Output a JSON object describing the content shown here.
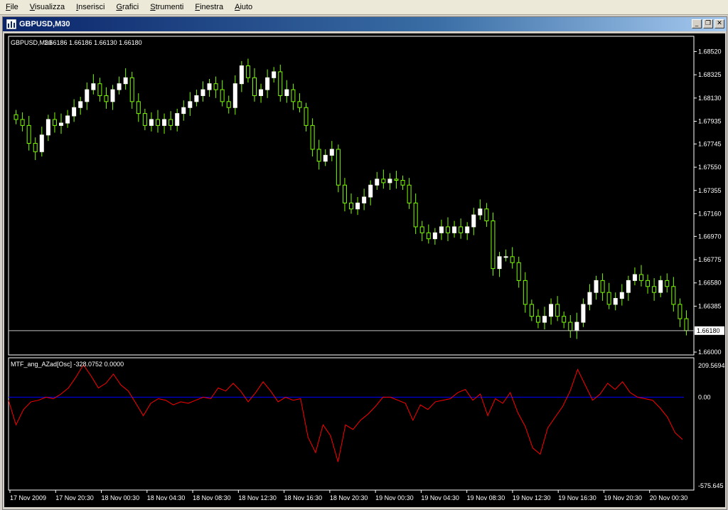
{
  "menu": [
    "File",
    "Visualizza",
    "Inserisci",
    "Grafici",
    "Strumenti",
    "Finestra",
    "Aiuto"
  ],
  "window": {
    "title": "GBPUSD,M30"
  },
  "price_panel": {
    "header_symbol": "GBPUSD,M30",
    "header_ohlc": "1.66186 1.66186 1.66130 1.66180",
    "current_price_label": "1.66180",
    "current_price": 1.6618
  },
  "indicator_panel": {
    "header": "MTF_ang_AZad[Osc] -328.0752 0.0000",
    "zero_label": "0.00",
    "top_label": "209.5694",
    "bottom_label": "-575.645"
  },
  "colors": {
    "background": "#000000",
    "grid": "#ffffff",
    "bull_candle": "#ffffff",
    "wick": "#7cfc00",
    "indicator_line": "#ff0000",
    "zero_line": "#0000ff",
    "current_price_line": "#c0c0c0"
  },
  "chart_data": [
    {
      "type": "candlestick",
      "title": "GBPUSD,M30",
      "y_ticks": [
        1.6852,
        1.68325,
        1.6813,
        1.67935,
        1.67745,
        1.6755,
        1.67355,
        1.6716,
        1.6697,
        1.66775,
        1.6658,
        1.66385,
        1.66
      ],
      "y_tick_labels": [
        "1.68520",
        "1.68325",
        "1.68130",
        "1.67935",
        "1.67745",
        "1.67550",
        "1.67355",
        "1.67160",
        "1.66970",
        "1.66775",
        "1.66580",
        "1.66385",
        "1.66000"
      ],
      "ylim": [
        1.66,
        1.686
      ],
      "x_tick_labels": [
        "17 Nov 2009",
        "17 Nov 20:30",
        "18 Nov 00:30",
        "18 Nov 04:30",
        "18 Nov 08:30",
        "18 Nov 12:30",
        "18 Nov 16:30",
        "18 Nov 20:30",
        "19 Nov 00:30",
        "19 Nov 04:30",
        "19 Nov 08:30",
        "19 Nov 12:30",
        "19 Nov 16:30",
        "19 Nov 20:30",
        "20 Nov 00:30"
      ],
      "closes": [
        1.6795,
        1.679,
        1.6775,
        1.6768,
        1.6782,
        1.6795,
        1.679,
        1.6792,
        1.6798,
        1.6805,
        1.681,
        1.682,
        1.6825,
        1.6815,
        1.681,
        1.682,
        1.6825,
        1.683,
        1.681,
        1.68,
        1.679,
        1.6795,
        1.679,
        1.6795,
        1.679,
        1.68,
        1.6805,
        1.681,
        1.6815,
        1.682,
        1.6825,
        1.682,
        1.681,
        1.6805,
        1.6825,
        1.684,
        1.683,
        1.6815,
        1.682,
        1.683,
        1.6835,
        1.6815,
        1.682,
        1.681,
        1.6805,
        1.679,
        1.677,
        1.676,
        1.6765,
        1.677,
        1.674,
        1.6725,
        1.672,
        1.6725,
        1.673,
        1.674,
        1.6745,
        1.6742,
        1.6745,
        1.6744,
        1.674,
        1.6725,
        1.6705,
        1.67,
        1.6695,
        1.67,
        1.6705,
        1.67,
        1.6705,
        1.67,
        1.6705,
        1.6715,
        1.672,
        1.671,
        1.667,
        1.668,
        1.668,
        1.6675,
        1.666,
        1.664,
        1.663,
        1.6625,
        1.663,
        1.664,
        1.663,
        1.6625,
        1.6618,
        1.6625,
        1.664,
        1.665,
        1.666,
        1.665,
        1.664,
        1.6645,
        1.665,
        1.666,
        1.6665,
        1.666,
        1.6655,
        1.665,
        1.666,
        1.6655,
        1.664,
        1.6628,
        1.6618
      ]
    },
    {
      "type": "line",
      "title": "MTF_ang_AZad[Osc] -328.0752 0.0000",
      "ylim": [
        -575.645,
        209.5694
      ],
      "y_tick_labels": [
        "209.5694",
        "0.00",
        "-575.645"
      ],
      "series": [
        {
          "values": [
            -20,
            -180,
            -80,
            -30,
            -20,
            0,
            -10,
            20,
            60,
            130,
            210,
            140,
            60,
            90,
            150,
            80,
            40,
            -40,
            -120,
            -40,
            -10,
            -20,
            -50,
            -30,
            -40,
            -20,
            0,
            -10,
            60,
            40,
            90,
            40,
            -30,
            30,
            100,
            40,
            -30,
            0,
            -20,
            -10,
            -260,
            -360,
            -180,
            -250,
            -420,
            -180,
            -210,
            -150,
            -110,
            -60,
            0,
            0,
            -20,
            -40,
            -150,
            -50,
            -80,
            -30,
            -20,
            -10,
            30,
            50,
            -20,
            20,
            -120,
            -10,
            -40,
            30,
            -100,
            -190,
            -330,
            -370,
            -200,
            -130,
            -60,
            40,
            180,
            80,
            -20,
            20,
            90,
            50,
            100,
            30,
            0,
            -10,
            -20,
            -70,
            -130,
            -230,
            -275
          ]
        }
      ]
    }
  ]
}
